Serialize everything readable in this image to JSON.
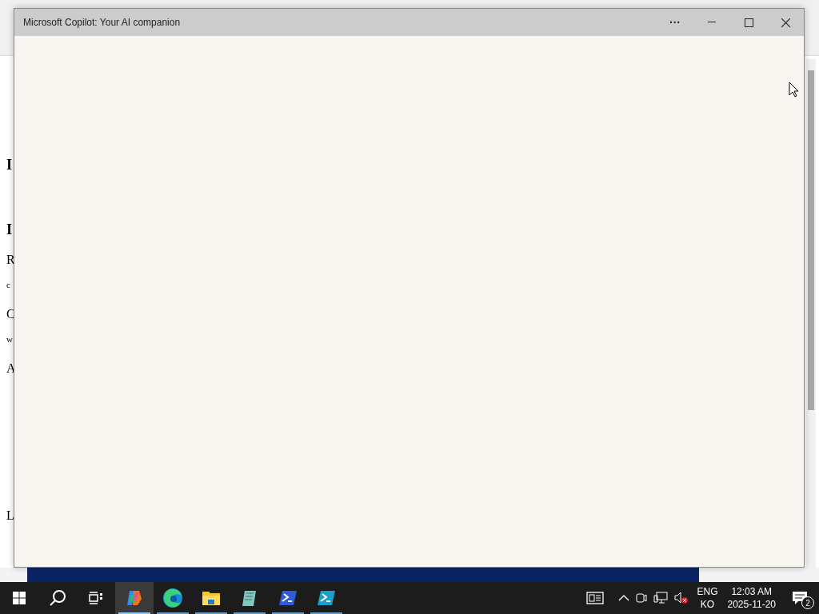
{
  "background_page": {
    "fragments": [
      {
        "text": "I",
        "kind": "h3first"
      },
      {
        "text": "I",
        "kind": "h3gap"
      },
      {
        "text": "R",
        "kind": "p"
      },
      {
        "text": "c",
        "kind": "small"
      },
      {
        "text": "C",
        "kind": "p"
      },
      {
        "text": "w",
        "kind": "small"
      },
      {
        "text": "A",
        "kind": "p"
      },
      {
        "text": "L",
        "kind": "pgap"
      }
    ]
  },
  "window": {
    "title": "Microsoft Copilot: Your AI companion",
    "menu": "···"
  },
  "taskbar": {
    "apps": [
      {
        "kind": "copilot",
        "selected": true
      },
      {
        "kind": "edge",
        "selected": false
      },
      {
        "kind": "folder",
        "selected": false
      },
      {
        "kind": "notepad",
        "selected": false
      },
      {
        "kind": "powershell",
        "selected": false
      },
      {
        "kind": "terminal",
        "selected": false
      }
    ],
    "language": {
      "top": "ENG",
      "bottom": "KO"
    },
    "clock": {
      "time": "12:03 AM",
      "date": "2025-11-20"
    },
    "notifications": {
      "count": "2"
    }
  }
}
